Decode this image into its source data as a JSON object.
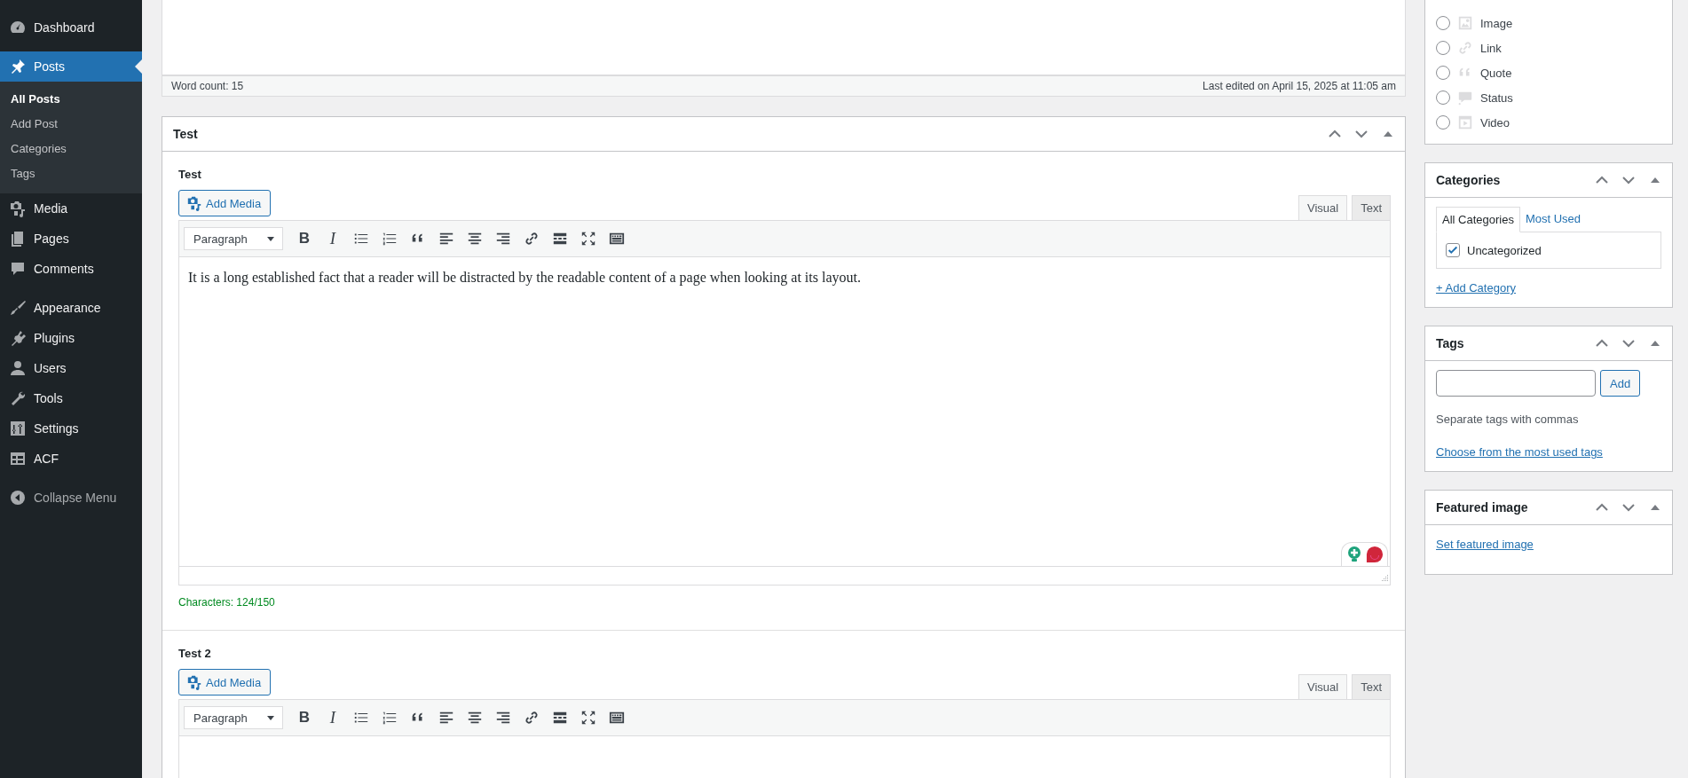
{
  "sidebar": {
    "groups": [
      [
        {
          "label": "Dashboard",
          "selected": false
        }
      ],
      [
        {
          "label": "Posts",
          "selected": true,
          "children": [
            {
              "label": "All Posts",
              "selected": true
            },
            {
              "label": "Add Post",
              "selected": false
            },
            {
              "label": "Categories",
              "selected": false
            },
            {
              "label": "Tags",
              "selected": false
            }
          ]
        },
        {
          "label": "Media",
          "selected": false
        },
        {
          "label": "Pages",
          "selected": false
        },
        {
          "label": "Comments",
          "selected": false
        }
      ],
      [
        {
          "label": "Appearance",
          "selected": false
        },
        {
          "label": "Plugins",
          "selected": false
        },
        {
          "label": "Users",
          "selected": false
        },
        {
          "label": "Tools",
          "selected": false
        },
        {
          "label": "Settings",
          "selected": false
        },
        {
          "label": "ACF",
          "selected": false
        }
      ]
    ],
    "collapse": "Collapse Menu"
  },
  "content_editor": {
    "word_count": "Word count: 15",
    "last_edited": "Last edited on April 15, 2025 at 11:05 am"
  },
  "metabox": {
    "title": "Test",
    "fields": [
      {
        "label": "Test",
        "add_media": "Add Media",
        "tabs": [
          {
            "label": "Visual",
            "selected": true
          },
          {
            "label": "Text",
            "selected": false
          }
        ],
        "format": "Paragraph",
        "bold": "B",
        "italic": "I",
        "content": "It is a long established fact that a reader will be distracted by the readable content of a page when looking at its layout.",
        "assistant_widget": true,
        "char_count": "Characters: 124/150"
      },
      {
        "label": "Test 2",
        "add_media": "Add Media",
        "tabs": [
          {
            "label": "Visual",
            "selected": true
          },
          {
            "label": "Text",
            "selected": false
          }
        ],
        "format": "Paragraph",
        "bold": "B",
        "italic": "I"
      }
    ]
  },
  "format_options": [
    {
      "label": "Image",
      "selected": false
    },
    {
      "label": "Link",
      "selected": false
    },
    {
      "label": "Quote",
      "selected": false
    },
    {
      "label": "Status",
      "selected": false
    },
    {
      "label": "Video",
      "selected": false
    }
  ],
  "categories": {
    "title": "Categories",
    "tabs": [
      {
        "label": "All Categories",
        "selected": true
      },
      {
        "label": "Most Used",
        "selected": false
      }
    ],
    "items": [
      {
        "label": "Uncategorized",
        "checked": true
      }
    ],
    "add_link": "+ Add Category"
  },
  "tags": {
    "title": "Tags",
    "button": "Add",
    "hint": "Separate tags with commas",
    "link": "Choose from the most used tags"
  },
  "featured_image": {
    "title": "Featured image",
    "link": "Set featured image"
  }
}
